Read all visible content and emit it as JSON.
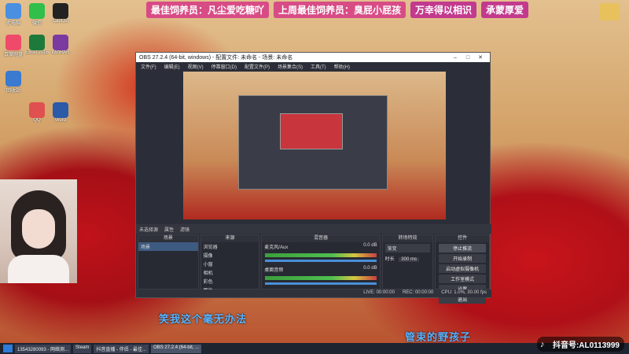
{
  "banner": {
    "chips": [
      "最佳饲养员：凡尘爱吃糖吖",
      "上周最佳饲养员：臭屁小屁孩",
      "万幸得以相识",
      "承蒙厚爱"
    ]
  },
  "desktop_icons": [
    {
      "label": "此电脑",
      "color": "#4a8fe0"
    },
    {
      "label": "微信",
      "color": "#2fbf4a"
    },
    {
      "label": "CapCut",
      "color": "#222222"
    },
    {
      "label": "百度网盘",
      "color": "#f04a6a"
    },
    {
      "label": "Excel 2016",
      "color": "#1e7a3a"
    },
    {
      "label": "WinRAR",
      "color": "#7a3aa0"
    },
    {
      "label": "回收站",
      "color": "#3a7ad0"
    },
    {
      "label": "QQ",
      "color": "#e05050"
    },
    {
      "label": "Word",
      "color": "#2a5aa8"
    }
  ],
  "obs": {
    "title": "OBS 27.2.4 (64-bit, windows) - 配置文件: 未命名 - 场景: 未命名",
    "menus": [
      "文件(F)",
      "编辑(E)",
      "视图(V)",
      "停靠窗口(D)",
      "配置文件(P)",
      "场景集合(S)",
      "工具(T)",
      "帮助(H)"
    ],
    "scene_bar": [
      "未选择源",
      "属性",
      "滤镜"
    ],
    "docks": {
      "scenes_title": "场景",
      "scenes": [
        "场景"
      ],
      "sources_title": "来源",
      "sources": [
        "浏览器",
        "摄像",
        "小窗",
        "相机",
        "彩色",
        "图片"
      ],
      "mixer_title": "混音器",
      "mixer": [
        {
          "name": "麦克风/Aux",
          "level": "0.0 dB"
        },
        {
          "name": "桌面音频",
          "level": "0.0 dB"
        }
      ],
      "transitions_title": "转场特效",
      "transition_value": "渐变",
      "duration_label": "时长",
      "duration_value": "300 ms",
      "controls_title": "控件",
      "controls": [
        "停止推流",
        "开始录制",
        "启动虚拟摄像机",
        "工作室模式",
        "设置",
        "退出"
      ]
    },
    "status": [
      "LIVE: 00:00:00",
      "REC: 00:00:00",
      "CPU: 1.0%, 30.00 fps"
    ]
  },
  "lyrics": {
    "line1": "笑我这个毫无办法",
    "line2": "管束的野孩子"
  },
  "taskbar": {
    "items": [
      "13543280093 - 网络测...",
      "Steam",
      "抖音直播 - 伴侣 - 最佳...",
      "OBS 27.2.4 (64-bit, ..."
    ]
  },
  "tiktok": {
    "label": "抖音号:AL0113999"
  }
}
